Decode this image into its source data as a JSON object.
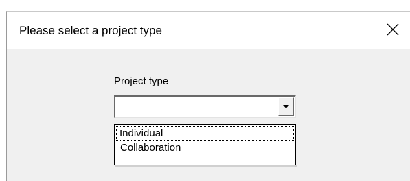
{
  "dialog": {
    "title": "Please select a project type",
    "close_icon": "close-icon"
  },
  "form": {
    "label": "Project type",
    "combo_value": "",
    "dropdown_icon": "chevron-down-icon",
    "options": [
      "Individual",
      "Collaboration"
    ],
    "focused_index": 0
  },
  "colors": {
    "title_bar": "#ffffff",
    "client_area": "#f0f0f0",
    "text": "#000000"
  }
}
